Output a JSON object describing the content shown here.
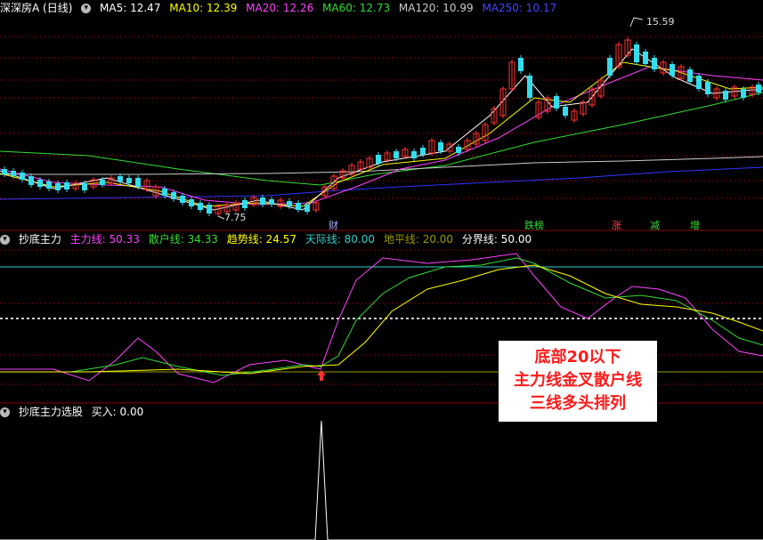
{
  "main_panel": {
    "title": "深深房A (日线)",
    "indicators": [
      {
        "label": "MA5: 12.47",
        "color": "#ffffff"
      },
      {
        "label": "MA10: 12.39",
        "color": "#ffff00"
      },
      {
        "label": "MA20: 12.26",
        "color": "#ff44ff"
      },
      {
        "label": "MA60: 12.73",
        "color": "#33dd33"
      },
      {
        "label": "MA120: 10.99",
        "color": "#cccccc"
      },
      {
        "label": "MA250: 10.17",
        "color": "#3333ff"
      }
    ],
    "price_high": "15.59",
    "price_low": "7.75",
    "markers": [
      {
        "text": "财",
        "color": "#aaaaff"
      },
      {
        "text": "跌榜",
        "color": "#33dd33"
      },
      {
        "text": "涨",
        "color": "#ff4444"
      },
      {
        "text": "减",
        "color": "#33dd33"
      },
      {
        "text": "增",
        "color": "#33dd33"
      }
    ]
  },
  "indicator_panel": {
    "title": "抄底主力",
    "values": [
      {
        "label": "主力线: 50.33",
        "color": "#ff44ff"
      },
      {
        "label": "散户线: 34.33",
        "color": "#33dd33"
      },
      {
        "label": "趋势线: 24.57",
        "color": "#ffff00"
      },
      {
        "label": "天际线: 80.00",
        "color": "#33cccc"
      },
      {
        "label": "地平线: 20.00",
        "color": "#999900"
      },
      {
        "label": "分界线: 50.00",
        "color": "#ffffff"
      }
    ]
  },
  "select_panel": {
    "title": "抄底主力选股",
    "buy_label": "买入: 0.00"
  },
  "annotation": {
    "line1": "底部20以下",
    "line2": "主力线金叉散户线",
    "line3": "三线多头排列"
  }
}
